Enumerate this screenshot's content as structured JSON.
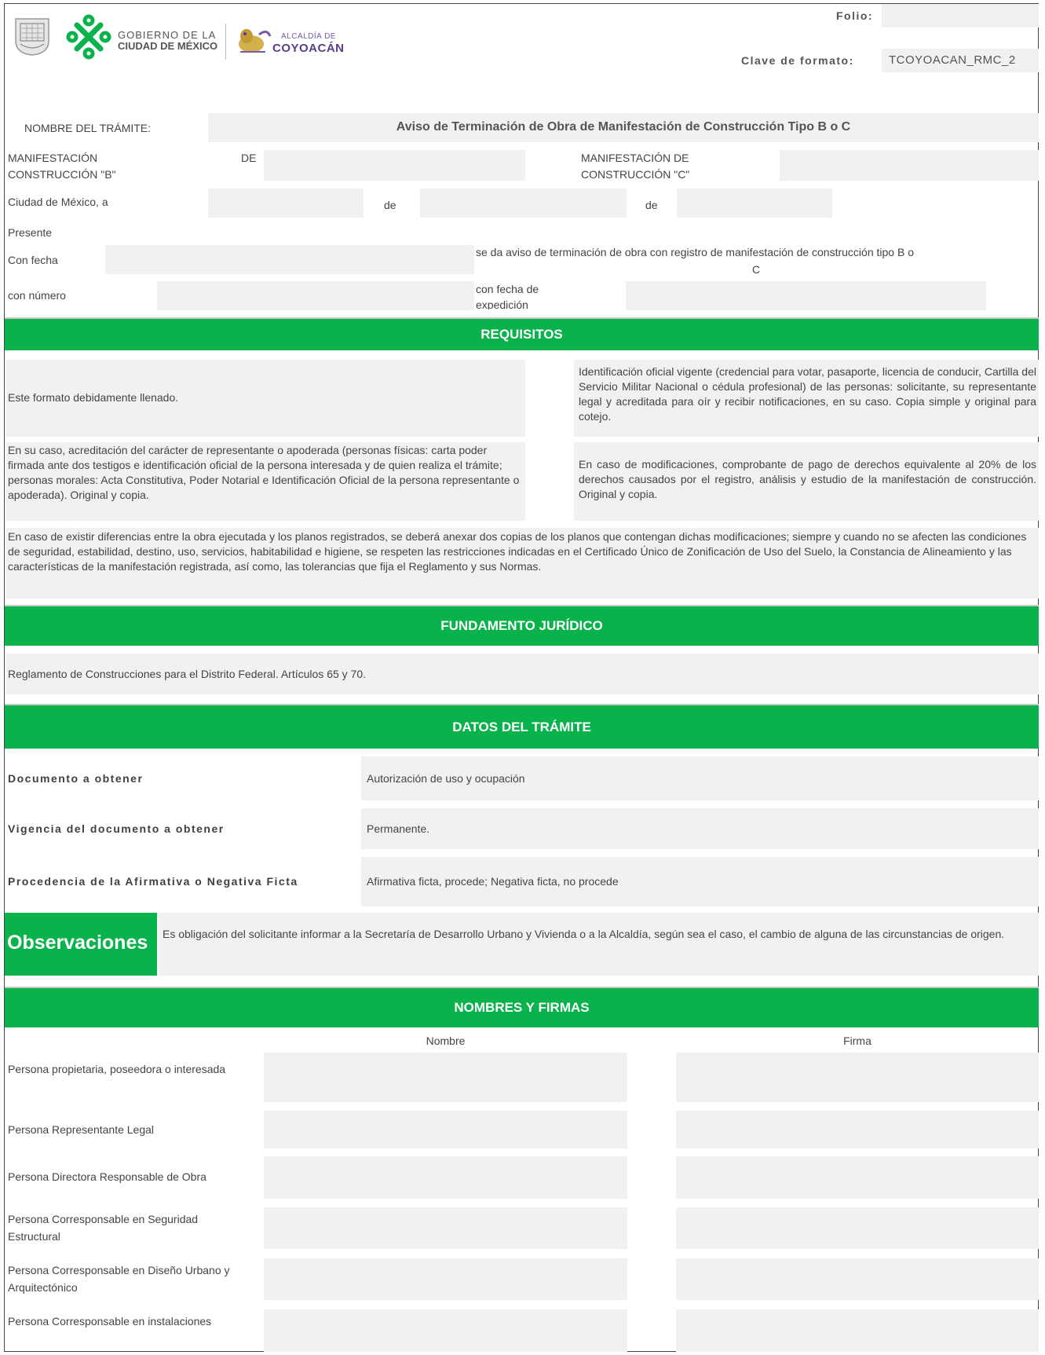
{
  "header": {
    "gov_line1": "GOBIERNO DE LA",
    "gov_line2": "CIUDAD DE MÉXICO",
    "alcaldia_small": "ALCALDÍA DE",
    "alcaldia_name": "COYOACÁN",
    "folio_label": "Folio:",
    "folio_value": "",
    "clave_label": "Clave de formato:",
    "clave_value": "TCOYOACAN_RMC_2"
  },
  "colors": {
    "accent": "#0ab24b",
    "field": "#f1f1f1"
  },
  "tramite": {
    "nombre_label": "NOMBRE DEL TRÁMITE:",
    "nombre_value": "Aviso de Terminación de Obra de Manifestación de Construcción Tipo B o C",
    "manif_b_label_1": "MANIFESTACIÓN",
    "manif_b_label_de": "DE",
    "manif_b_label_2": "CONSTRUCCIÓN \"B\"",
    "manif_c_label_1": "MANIFESTACIÓN DE",
    "manif_c_label_2": "CONSTRUCCIÓN \"C\"",
    "ciudad_label": "Ciudad de México, a",
    "de_1": "de",
    "de_2": "de",
    "presente": "Presente",
    "con_fecha": "Con fecha",
    "aviso_text_1": "se da aviso de terminación de obra con registro de manifestación de construcción tipo B o",
    "aviso_text_2": "C",
    "con_numero": "con número",
    "fecha_exp_1": "con fecha de",
    "fecha_exp_2": "expedición"
  },
  "requisitos": {
    "title": "REQUISITOS",
    "r1": "Este formato debidamente llenado.",
    "r2": "Identificación oficial vigente (credencial para votar, pasaporte, licencia de conducir, Cartilla del Servicio Militar Nacional o cédula profesional) de las personas: solicitante, su representante legal y acreditada para oír y recibir notificaciones, en su caso. Copia simple y original para cotejo.",
    "r3": "En su caso, acreditación del carácter de representante o apoderada (personas físicas: carta poder firmada ante dos testigos e identificación oficial de la persona interesada y de quien realiza el trámite; personas morales: Acta Constitutiva, Poder Notarial e Identificación Oficial de la persona representante o apoderada). Original y copia.",
    "r4": "En caso de modificaciones, comprobante de pago de derechos equivalente al 20% de los derechos causados por el registro, análisis y estudio de la manifestación de construcción. Original y copia.",
    "r5": "En caso de existir diferencias entre la obra ejecutada y los planos registrados, se deberá anexar dos copias de los planos que contengan dichas modificaciones; siempre y cuando no se afecten las condiciones de seguridad, estabilidad, destino, uso, servicios, habitabilidad e higiene, se respeten las restricciones indicadas en el Certificado Único de Zonificación de Uso del Suelo, la Constancia de Alineamiento y las características de la manifestación registrada, así como, las tolerancias que fija el Reglamento y sus Normas."
  },
  "fundamento": {
    "title": "FUNDAMENTO JURÍDICO",
    "text": "Reglamento de Construcciones para el Distrito Federal. Artículos 65 y 70."
  },
  "datos": {
    "title": "DATOS DEL TRÁMITE",
    "rows": [
      {
        "label": "Documento a obtener",
        "value": "Autorización de uso y ocupación"
      },
      {
        "label": "Vigencia del documento a obtener",
        "value": "Permanente."
      },
      {
        "label": "Procedencia de la Afirmativa o Negativa Ficta",
        "value": "Afirmativa ficta, procede; Negativa ficta, no procede"
      }
    ]
  },
  "observaciones": {
    "label": "Observaciones",
    "text": "Es obligación del solicitante informar a la Secretaría de Desarrollo Urbano y Vivienda o a la Alcaldía, según sea el caso, el cambio de alguna de las circunstancias de origen."
  },
  "firmas": {
    "title": "NOMBRES Y FIRMAS",
    "col_nombre": "Nombre",
    "col_firma": "Firma",
    "rows": [
      {
        "label": "Persona propietaria, poseedora o interesada"
      },
      {
        "label": "Persona Representante Legal"
      },
      {
        "label": "Persona Directora Responsable de Obra"
      },
      {
        "label": "Persona Corresponsable en Seguridad Estructural"
      },
      {
        "label": "Persona Corresponsable en Diseño Urbano y Arquitectónico"
      },
      {
        "label": "Persona Corresponsable en instalaciones"
      }
    ]
  }
}
